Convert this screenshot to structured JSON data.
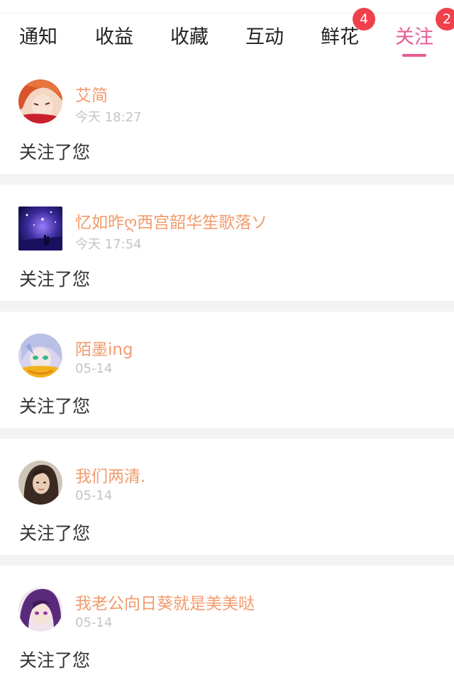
{
  "tabs": [
    {
      "label": "通知"
    },
    {
      "label": "收益"
    },
    {
      "label": "收藏"
    },
    {
      "label": "互动"
    },
    {
      "label": "鲜花",
      "badge": "4"
    },
    {
      "label": "关注",
      "badge": "2",
      "active": true
    }
  ],
  "accent_color": "#e85c94",
  "badge_color": "#f0404c",
  "name_color": "#f29b6c",
  "notifications": [
    {
      "name": "艾简",
      "time": "今天 18:27",
      "action": "关注了您",
      "avatar": "anime-redhead-avatar"
    },
    {
      "name": "忆如昨ღ西宫韶华笙歌落ソ",
      "time": "今天 17:54",
      "action": "关注了您",
      "avatar": "night-scene-avatar"
    },
    {
      "name": "陌墨ing",
      "time": "05-14",
      "action": "关注了您",
      "avatar": "anime-silverhair-avatar"
    },
    {
      "name": "我们两清.",
      "time": "05-14",
      "action": "关注了您",
      "avatar": "photo-girl-avatar"
    },
    {
      "name": "我老公向日葵就是美美哒",
      "time": "05-14",
      "action": "关注了您",
      "avatar": "anime-purplehair-avatar"
    }
  ]
}
